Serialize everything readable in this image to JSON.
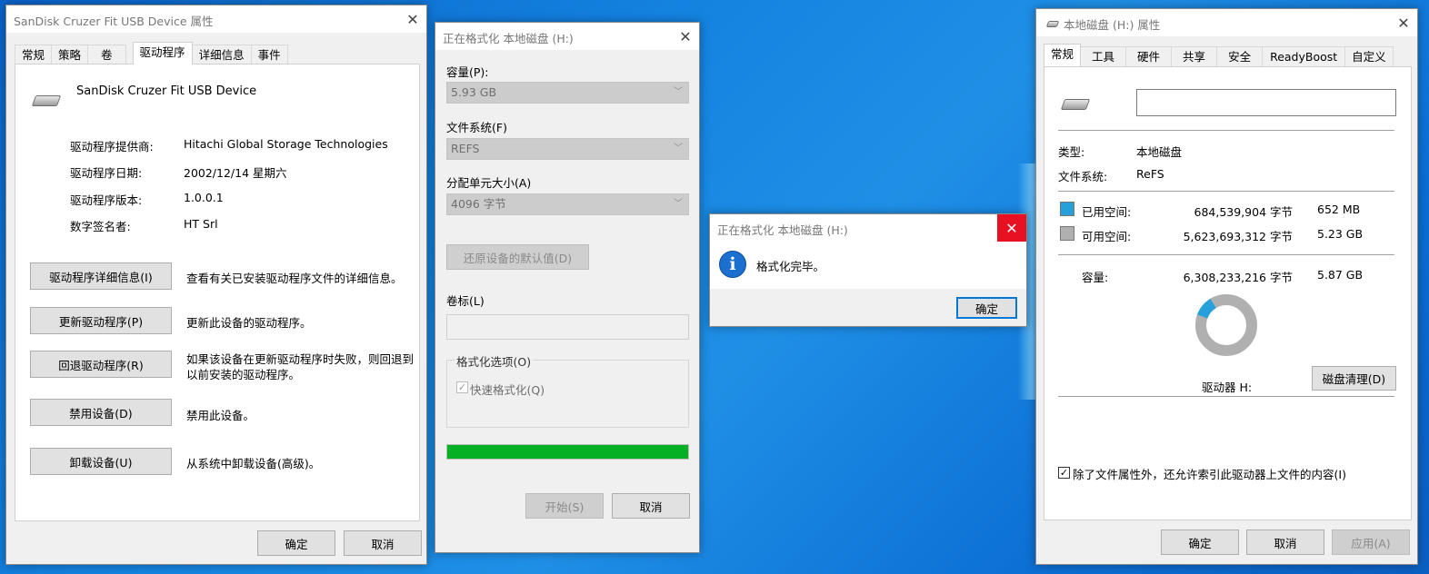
{
  "usb_dialog": {
    "title": "SanDisk Cruzer Fit USB Device 属性",
    "tabs": [
      "常规",
      "策略",
      "卷",
      "驱动程序",
      "详细信息",
      "事件"
    ],
    "device_name": "SanDisk Cruzer Fit USB Device",
    "props": [
      {
        "label": "驱动程序提供商:",
        "value": "Hitachi Global Storage Technologies"
      },
      {
        "label": "驱动程序日期:",
        "value": "2002/12/14 星期六"
      },
      {
        "label": "驱动程序版本:",
        "value": "1.0.0.1"
      },
      {
        "label": "数字签名者:",
        "value": "HT Srl"
      }
    ],
    "actions": [
      {
        "button": "驱动程序详细信息(I)",
        "desc": "查看有关已安装驱动程序文件的详细信息。"
      },
      {
        "button": "更新驱动程序(P)",
        "desc": "更新此设备的驱动程序。"
      },
      {
        "button": "回退驱动程序(R)",
        "desc": "如果该设备在更新驱动程序时失败，则回退到",
        "desc2": "以前安装的驱动程序。"
      },
      {
        "button": "禁用设备(D)",
        "desc": "禁用此设备。"
      },
      {
        "button": "卸载设备(U)",
        "desc": "从系统中卸载设备(高级)。"
      }
    ],
    "ok": "确定",
    "cancel": "取消"
  },
  "format_dialog": {
    "title": "正在格式化 本地磁盘 (H:)",
    "capacity_label": "容量(P):",
    "capacity_value": "5.93 GB",
    "fs_label": "文件系统(F)",
    "fs_value": "REFS",
    "alloc_label": "分配单元大小(A)",
    "alloc_value": "4096 字节",
    "restore_button": "还原设备的默认值(D)",
    "volume_label": "卷标(L)",
    "volume_value": "",
    "options_label": "格式化选项(O)",
    "quick_format": "快速格式化(Q)",
    "quick_format_checked": true,
    "progress": 1.0,
    "start": "开始(S)",
    "cancel": "取消"
  },
  "message_box": {
    "title": "正在格式化 本地磁盘 (H:)",
    "message": "格式化完毕。",
    "ok": "确定",
    "icon": "info-icon"
  },
  "disk_dialog": {
    "title": "本地磁盘 (H:) 属性",
    "tabs": [
      "常规",
      "工具",
      "硬件",
      "共享",
      "安全",
      "ReadyBoost",
      "自定义"
    ],
    "volume_name": "",
    "type_label": "类型:",
    "type_value": "本地磁盘",
    "fs_label": "文件系统:",
    "fs_value": "ReFS",
    "used_label": "已用空间:",
    "used_bytes": "684,539,904 字节",
    "used_size": "652 MB",
    "free_label": "可用空间:",
    "free_bytes": "5,623,693,312 字节",
    "free_size": "5.23 GB",
    "capacity_label": "容量:",
    "capacity_bytes": "6,308,233,216 字节",
    "capacity_size": "5.87 GB",
    "used_fraction": 0.1085,
    "used_color": "#26a0da",
    "free_color": "#b0b0b0",
    "drive_label": "驱动器 H:",
    "cleanup_button": "磁盘清理(D)",
    "index_checkbox": "除了文件属性外，还允许索引此驱动器上文件的内容(I)",
    "index_checked": true,
    "ok": "确定",
    "cancel": "取消",
    "apply": "应用(A)"
  }
}
